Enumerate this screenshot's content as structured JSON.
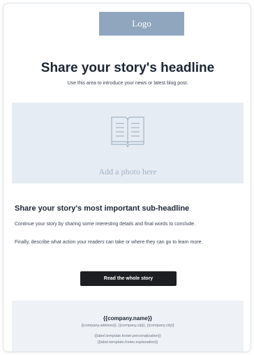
{
  "header": {
    "logo_text": "Logo"
  },
  "hero": {
    "headline": "Share your story's headline",
    "intro": "Use this area to introduce your news or latest blog post."
  },
  "photo": {
    "icon": "open-book-icon",
    "label": "Add a photo here"
  },
  "body": {
    "subheadline": "Share your story's most important sub-headline",
    "paragraph1": "Continue your story by sharing some interesting details and final words to conclude.",
    "paragraph2": "Finally, describe what action your readers can take or where they can go to learn more."
  },
  "cta": {
    "label": "Read the whole story"
  },
  "footer": {
    "company_name": "{{company.name}}",
    "address": "{{company.address}}, {{company.zip}}, {{company.city}}",
    "personalization": "{{label.template.footer.personalization}}",
    "explanation": "{{label.template.footer.explanation}}"
  },
  "colors": {
    "logo_bg": "#8fa6be",
    "photo_bg": "#e6ecf3",
    "button_bg": "#1c1e21",
    "footer_bg": "#eef1f5",
    "text": "#1c2634"
  }
}
